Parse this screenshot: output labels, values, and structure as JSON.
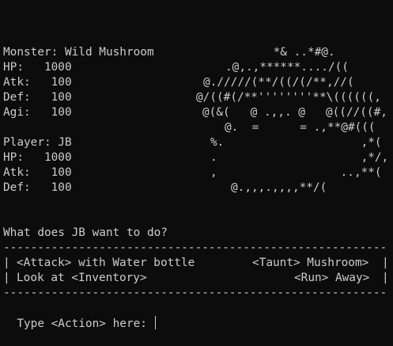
{
  "monster": {
    "label": "Monster: Wild Mushroom",
    "hp": "HP:   1000",
    "atk": "Atk:   100",
    "def": "Def:   100",
    "agi": "Agi:   100"
  },
  "player": {
    "label": "Player: JB",
    "hp": "HP:   1000",
    "atk": "Atk:   100",
    "def": "Def:   100"
  },
  "ascii_art": [
    "       *& ..*#@.",
    ".@,.,******..../((",
    "@./////(**/((/(/**,//(",
    "@/((#(/**''''''''**\\((((((,",
    "@(&(   @ .,,. @   @((//((#,",
    "   @.  =      = .,**@#(((",
    "%.                    ,*(",
    ".                     ,*/,",
    ",                  ..,**(",
    "   @.,,,.,,,,**/("
  ],
  "question": "What does JB want to do?",
  "rule": "--------------------------------------------------------",
  "menu": {
    "attack": "<Attack> with Water bottle",
    "taunt": "<Taunt> Mushroom>",
    "inventory": "Look at <Inventory>",
    "run": "<Run> Away>"
  },
  "prompt": "Type <Action> here: "
}
